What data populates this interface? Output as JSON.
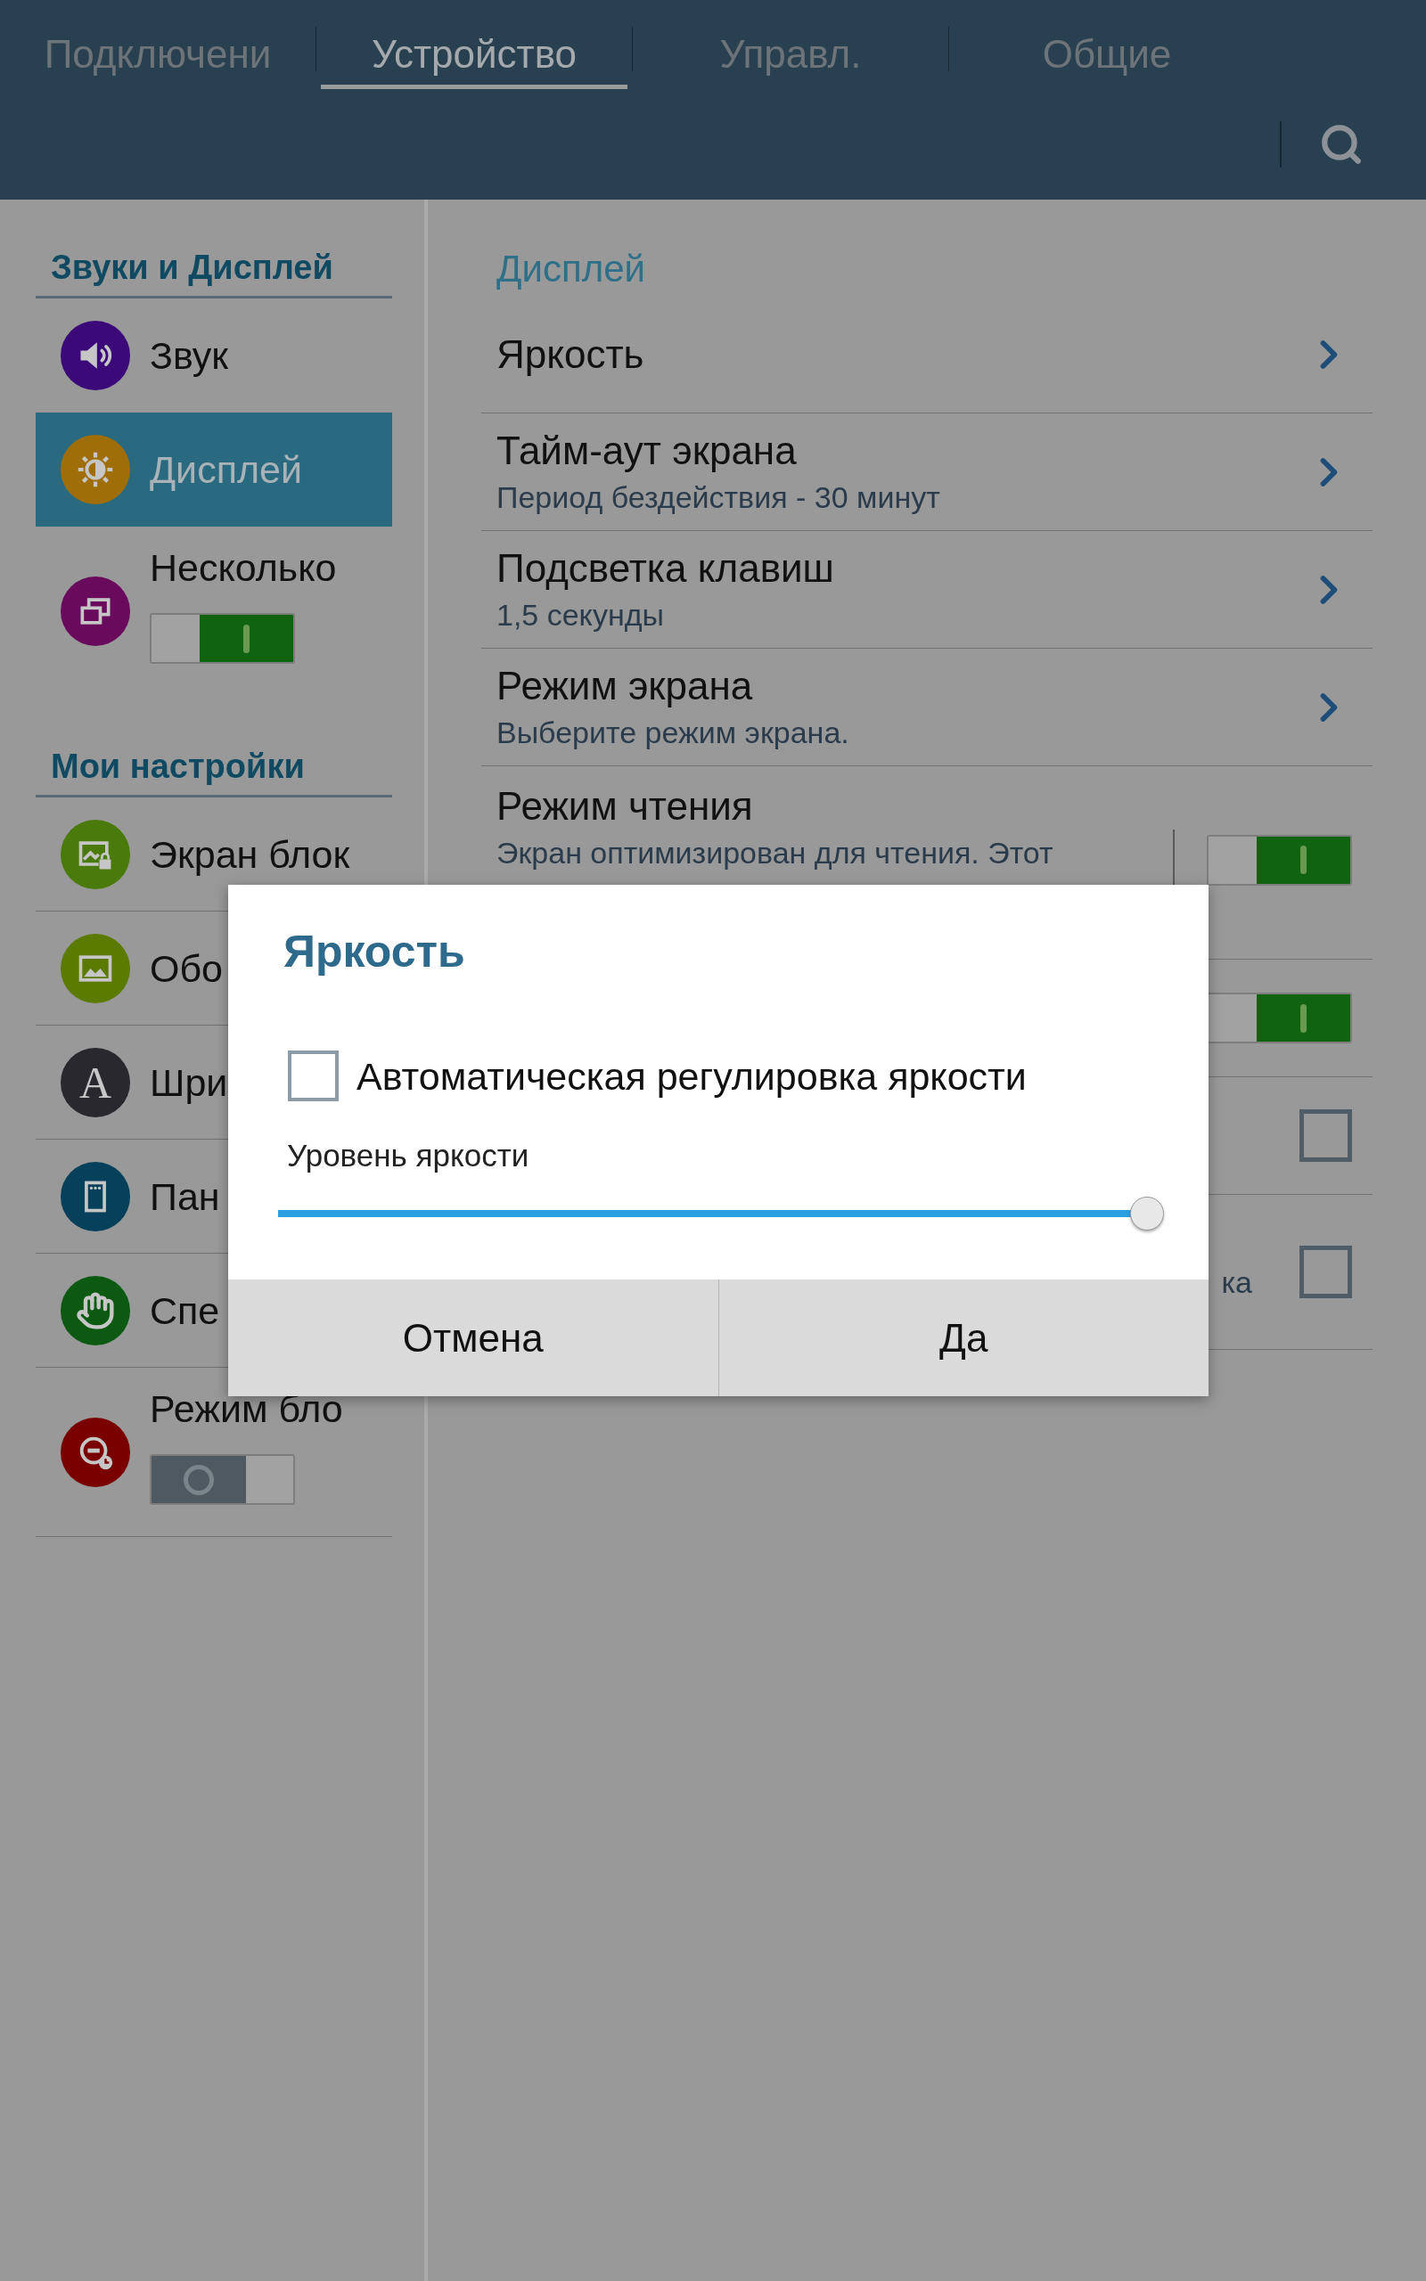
{
  "tabs": [
    {
      "label": "Подключени",
      "selected": false
    },
    {
      "label": "Устройство",
      "selected": true
    },
    {
      "label": "Управл.",
      "selected": false
    },
    {
      "label": "Общие",
      "selected": false
    }
  ],
  "sidebar": {
    "sections": [
      {
        "title": "Звуки и Дисплей",
        "items": [
          {
            "kind": "link",
            "label": "Звук",
            "selected": false,
            "color": "#3b0a78"
          },
          {
            "kind": "link",
            "label": "Дисплей",
            "selected": true,
            "color": "#a06e08"
          },
          {
            "kind": "toggle",
            "label": "Несколько",
            "selected": false,
            "color": "#6a0a5c",
            "on": true
          }
        ]
      },
      {
        "title": "Мои настройки",
        "items": [
          {
            "kind": "link",
            "label": "Экран блок",
            "selected": false,
            "color": "#4a7a0a"
          },
          {
            "kind": "link",
            "label": "Обо",
            "selected": false,
            "color": "#5a7a00"
          },
          {
            "kind": "link",
            "label": "Шри",
            "selected": false,
            "color": "#28282e",
            "icon_text": "A"
          },
          {
            "kind": "link",
            "label": "Пан",
            "selected": false,
            "color": "#06405a"
          },
          {
            "kind": "link",
            "label": "Спе",
            "selected": false,
            "color": "#0c5a12"
          },
          {
            "kind": "toggle",
            "label": "Режим бло",
            "selected": false,
            "color": "#7a0000",
            "on": false
          }
        ]
      }
    ]
  },
  "content": {
    "title": "Дисплей",
    "rows": [
      {
        "kind": "link",
        "title": "Яркость"
      },
      {
        "kind": "link",
        "title": "Тайм-аут экрана",
        "summary": "Период бездействия - 30 минут"
      },
      {
        "kind": "link",
        "title": "Подсветка клавиш",
        "summary": "1,5 секунды"
      },
      {
        "kind": "link",
        "title": "Режим экрана",
        "summary": "Выберите режим экрана."
      },
      {
        "kind": "toggle",
        "title": "Режим чтения",
        "summary": "Экран оптимизирован для чтения. Этот",
        "on": true
      },
      {
        "kind": "toggle",
        "on": true
      },
      {
        "kind": "checkbox",
        "checked": false
      },
      {
        "kind": "checkbox",
        "summary": "ка",
        "checked": false
      }
    ]
  },
  "dialog": {
    "title": "Яркость",
    "checkbox": {
      "label": "Автоматическая регулировка яркости",
      "checked": false
    },
    "slider": {
      "label": "Уровень яркости",
      "level": 1
    },
    "buttons": [
      "Отмена",
      "Да"
    ]
  }
}
